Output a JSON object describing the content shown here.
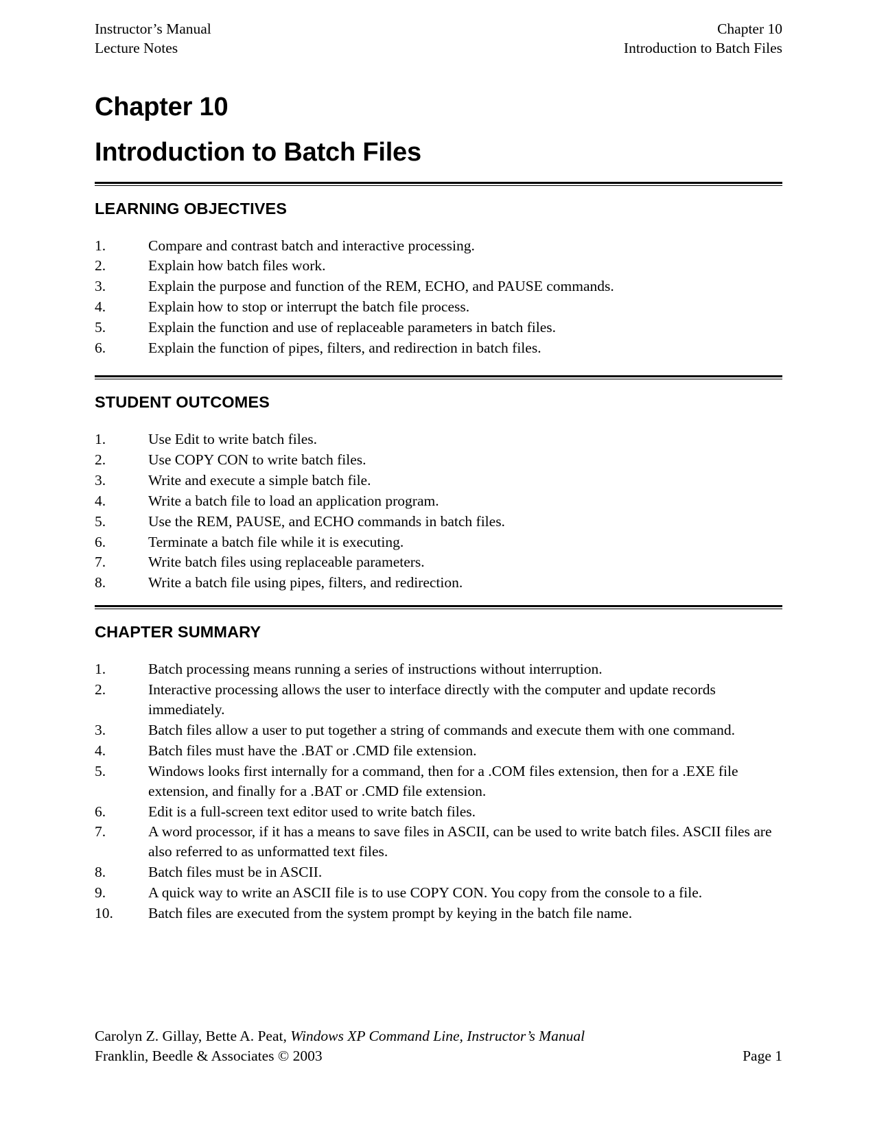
{
  "running_head": {
    "left_line1": "Instructor’s Manual",
    "left_line2": "Lecture Notes",
    "right_line1": "Chapter 10",
    "right_line2": "Introduction to Batch Files"
  },
  "chapter": {
    "number_label": "Chapter 10",
    "title": "Introduction to Batch Files"
  },
  "sections": {
    "objectives": {
      "heading": "LEARNING OBJECTIVES",
      "items": [
        {
          "num": "1.",
          "text": "Compare and contrast batch and interactive processing."
        },
        {
          "num": "2.",
          "text": "Explain how batch files work."
        },
        {
          "num": "3.",
          "text": "Explain the purpose and function of the REM, ECHO, and PAUSE commands."
        },
        {
          "num": "4.",
          "text": "Explain how to stop or interrupt the batch file process."
        },
        {
          "num": "5.",
          "text": "Explain the function and use of replaceable parameters in batch files."
        },
        {
          "num": "6.",
          "text": "Explain the function of pipes, filters, and redirection in batch files."
        }
      ]
    },
    "outcomes": {
      "heading": "STUDENT OUTCOMES",
      "items": [
        {
          "num": "1.",
          "text": "Use Edit to write batch files."
        },
        {
          "num": "2.",
          "text": "Use COPY CON to write batch files."
        },
        {
          "num": "3.",
          "text": "Write and execute a simple batch file."
        },
        {
          "num": "4.",
          "text": "Write a batch file to load an application program."
        },
        {
          "num": "5.",
          "text": "Use the REM, PAUSE, and ECHO commands in batch files."
        },
        {
          "num": "6.",
          "text": "Terminate a batch file while it is executing."
        },
        {
          "num": "7.",
          "text": "Write batch files using replaceable parameters."
        },
        {
          "num": "8.",
          "text": "Write a batch file using pipes, filters, and redirection."
        }
      ]
    },
    "summary": {
      "heading": "CHAPTER SUMMARY",
      "items": [
        {
          "num": "1.",
          "text": "Batch processing means running a series of instructions without interruption."
        },
        {
          "num": "2.",
          "text": "Interactive processing allows the user to interface directly with the computer and update records immediately."
        },
        {
          "num": "3.",
          "text": "Batch files allow a user to put together a string of commands and execute them with one command."
        },
        {
          "num": "4.",
          "text": "Batch files must have the .BAT or .CMD file extension."
        },
        {
          "num": "5.",
          "text": "Windows looks first internally for a command, then for a .COM files extension, then for a .EXE file extension, and finally for a .BAT or .CMD file extension."
        },
        {
          "num": "6.",
          "text": "Edit is a full-screen text editor used to write batch files."
        },
        {
          "num": "7.",
          "text": "A word processor, if it has a means to save files in ASCII, can be used to write batch files. ASCII files are also referred to as unformatted text files."
        },
        {
          "num": "8.",
          "text": "Batch files must be in ASCII."
        },
        {
          "num": "9.",
          "text": "A quick way to write an ASCII file is to use COPY CON.  You copy from the console to a file."
        },
        {
          "num": "10.",
          "text": "Batch files are executed from the system prompt by keying in the batch file name."
        }
      ]
    }
  },
  "footer": {
    "authors": "Carolyn Z. Gillay, Bette A. Peat, ",
    "work_title": "Windows XP Command Line, Instructor’s Manual",
    "publisher": "Franklin, Beedle & Associates © 2003",
    "page_label": "Page 1"
  }
}
